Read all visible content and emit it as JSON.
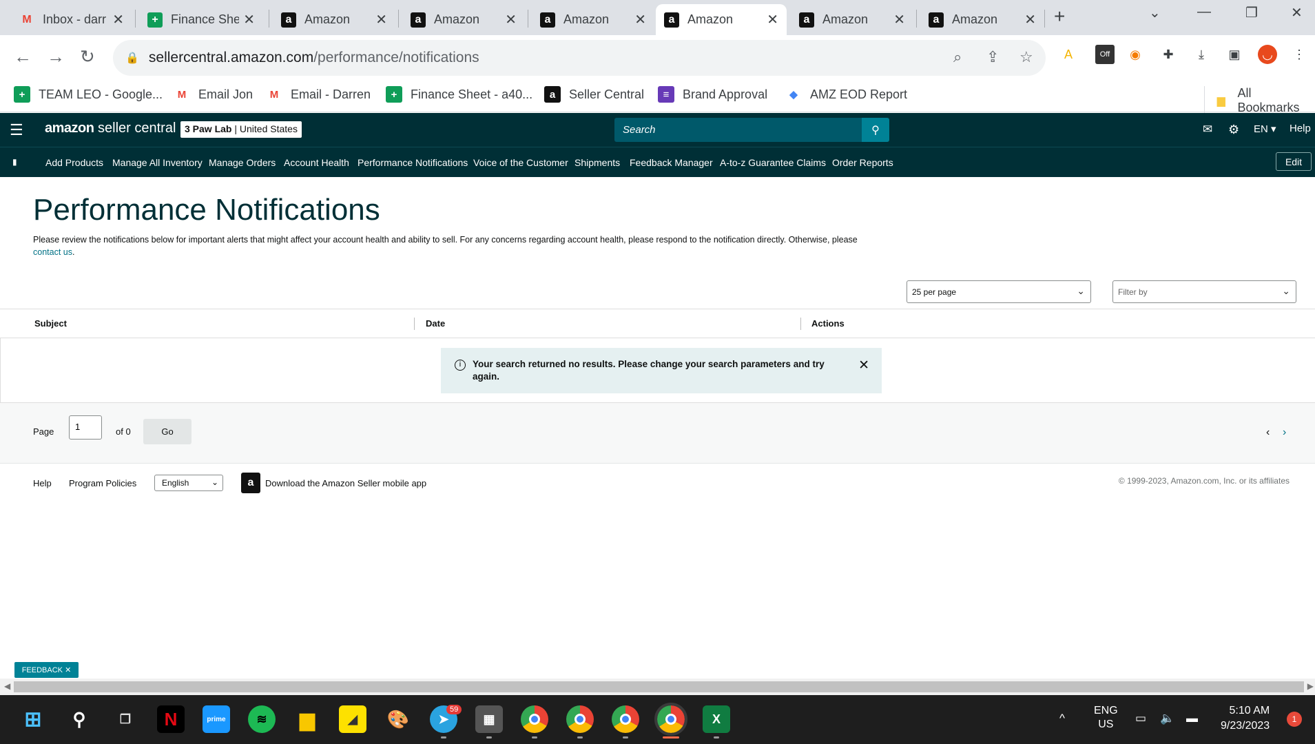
{
  "browser": {
    "tabs": [
      {
        "title": "Inbox - darr",
        "icon": "gmail-icon"
      },
      {
        "title": "Finance She",
        "icon": "sheets-icon"
      },
      {
        "title": "Amazon",
        "icon": "amazon-icon"
      },
      {
        "title": "Amazon",
        "icon": "amazon-icon"
      },
      {
        "title": "Amazon",
        "icon": "amazon-icon"
      },
      {
        "title": "Amazon",
        "icon": "amazon-icon",
        "active": true
      },
      {
        "title": "Amazon",
        "icon": "amazon-icon"
      },
      {
        "title": "Amazon",
        "icon": "amazon-icon"
      }
    ],
    "url_domain": "sellercentral.amazon.com",
    "url_path": "/performance/notifications",
    "ext_off_label": "Off",
    "bookmarks": [
      {
        "label": "TEAM LEO - Google...",
        "icon": "sheets-icon"
      },
      {
        "label": "Email Jon",
        "icon": "gmail-icon"
      },
      {
        "label": "Email - Darren",
        "icon": "gmail-icon"
      },
      {
        "label": "Finance Sheet - a40...",
        "icon": "sheets-icon"
      },
      {
        "label": "Seller Central",
        "icon": "amazon-icon"
      },
      {
        "label": "Brand Approval",
        "icon": "forms-icon"
      },
      {
        "label": "AMZ EOD Report",
        "icon": "report-icon"
      }
    ],
    "all_bookmarks": "All Bookmarks"
  },
  "header": {
    "logo_bold": "amazon",
    "logo_rest": " seller central",
    "store_name": "3 Paw Lab",
    "store_sep": " | ",
    "store_region": "United States",
    "search_placeholder": "Search",
    "lang": "EN",
    "help": "Help"
  },
  "nav": {
    "items": [
      "Add Products",
      "Manage All Inventory",
      "Manage Orders",
      "Account Health",
      "Performance Notifications",
      "Voice of the Customer",
      "Shipments",
      "Feedback Manager",
      "A-to-z Guarantee Claims",
      "Order Reports"
    ],
    "edit": "Edit"
  },
  "page": {
    "title": "Performance Notifications",
    "description": "Please review the notifications below for important alerts that might affect your account health and ability to sell. For any concerns regarding account health, please respond to the notification directly. Otherwise, please ",
    "contact_link": "contact us",
    "description_end": ".",
    "per_page": "25 per page",
    "filter_by": "Filter by"
  },
  "table": {
    "columns": [
      "Subject",
      "Date",
      "Actions"
    ],
    "alert": "Your search returned no results. Please change your search parameters and try again."
  },
  "pagination": {
    "page_label": "Page",
    "page_value": "1",
    "of_label": "of 0",
    "go": "Go"
  },
  "footer": {
    "help": "Help",
    "program_policies": "Program Policies",
    "language": "English",
    "app_link": "Download the Amazon Seller mobile app",
    "copyright": "© 1999-2023, Amazon.com, Inc. or its affiliates"
  },
  "feedback": "FEEDBACK",
  "taskbar": {
    "telegram_badge": "59",
    "lang": "ENG",
    "region": "US",
    "time": "5:10 AM",
    "date": "9/23/2023",
    "notif_count": "1"
  },
  "colors": {
    "header_bg": "#002f36",
    "accent": "#008296",
    "link": "#007185",
    "alert_bg": "#e5f0f1"
  }
}
